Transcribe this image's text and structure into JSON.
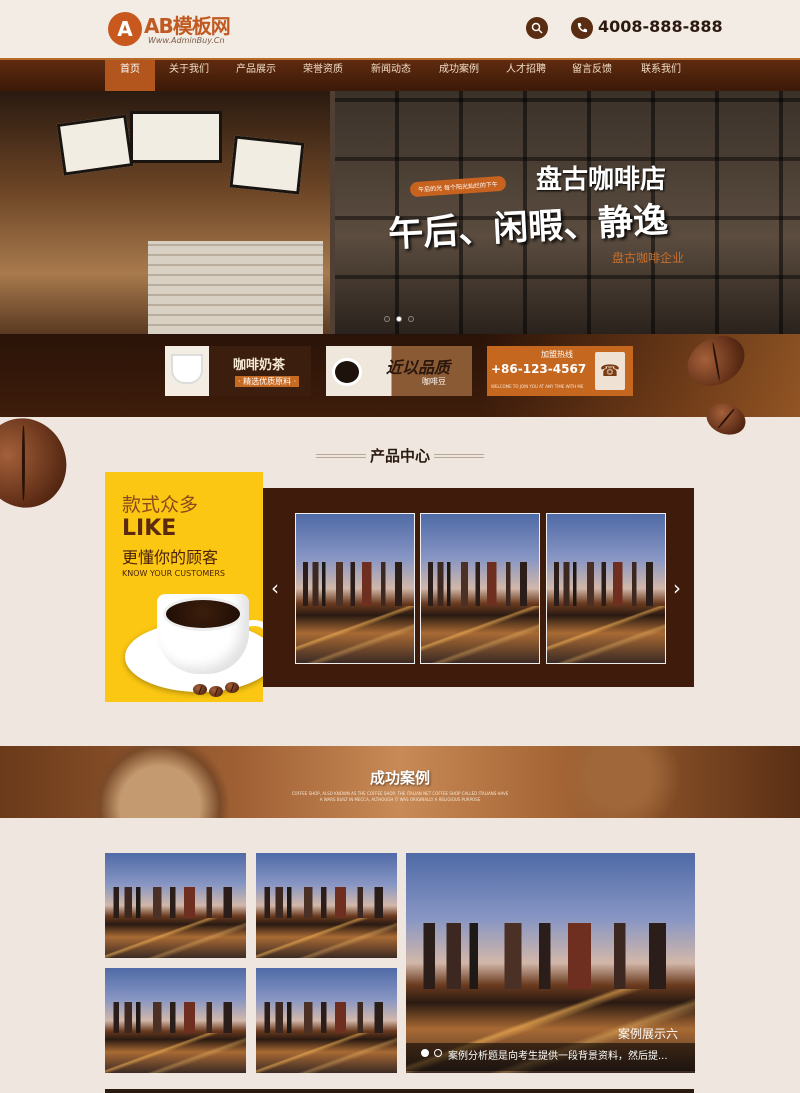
{
  "header": {
    "logo_mark": "A",
    "logo_title": "AB模板网",
    "logo_sub": "Www.AdminBuy.Cn",
    "phone": "4008-888-888"
  },
  "nav": {
    "items": [
      "首页",
      "关于我们",
      "产品展示",
      "荣誉资质",
      "新闻动态",
      "成功案例",
      "人才招聘",
      "留言反馈",
      "联系我们"
    ]
  },
  "banner": {
    "tagline": "午后的光 每个阳光灿烂的下午",
    "shop_name": "盘古咖啡店",
    "slogan": "午后、闲暇、静逸",
    "sub": "盘古咖啡企业"
  },
  "promos": {
    "milktea_title": "咖啡奶茶",
    "milktea_sub": "· 精选优质原料 ·",
    "beans_title": "近以品质",
    "beans_sub": "咖啡豆",
    "hotline_label": "加盟热线",
    "hotline_number": "+86-123-4567",
    "hotline_sub": "WELCOME TO JOIN YOU AT ANY TIME WITH ME"
  },
  "products": {
    "title": "产品中心",
    "promo_line1": "款式众多",
    "promo_line2": "LIKE",
    "promo_line3": "更懂你的顾客",
    "promo_line4": "KNOW YOUR CUSTOMERS",
    "prev_arrow": "‹",
    "next_arrow": "›"
  },
  "cases": {
    "title": "成功案例",
    "sub_line1": "COFFEE SHOP, ALSO KNOWN AS THE COFFEE SHOP, THE ITALIAN NET COFFEE SHOP CALLED ITALIANS HAVE",
    "sub_line2": "A WARS BUILT IN MECCA, ALTHOUGH IT WAS ORIGINALLY A RELIGIOUS PURPOSE",
    "caption_title": "案例展示六",
    "caption_desc": "案例分析题是向考生提供一段背景资料，然后提..."
  },
  "colors": {
    "brand": "#c05a21",
    "nav_bg": "#4a200b",
    "nav_active": "#b3561d",
    "promo_yellow": "#fbc712",
    "carousel_bg": "#3e1b0a"
  }
}
